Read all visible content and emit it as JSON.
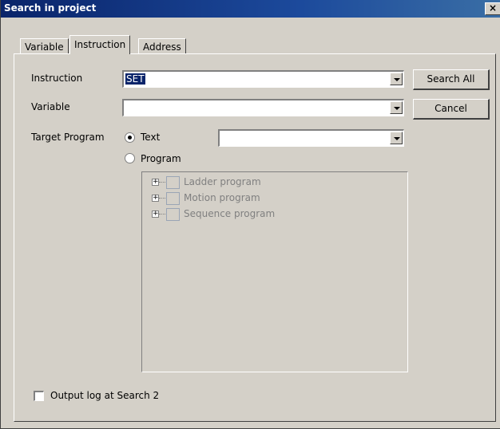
{
  "window": {
    "title": "Search in project",
    "close_glyph": "×"
  },
  "tabs": [
    {
      "label": "Variable",
      "active": false
    },
    {
      "label": "Instruction",
      "active": true
    },
    {
      "label": "Address",
      "active": false
    }
  ],
  "form": {
    "instruction_label": "Instruction",
    "instruction_value": "SET",
    "variable_label": "Variable",
    "variable_value": "",
    "target_label": "Target Program",
    "text_radio_label": "Text",
    "text_radio_selected": true,
    "text_combo_value": "",
    "program_radio_label": "Program",
    "program_radio_selected": false
  },
  "buttons": {
    "search_all": "Search All",
    "cancel": "Cancel"
  },
  "tree": {
    "items": [
      {
        "label": "Ladder program",
        "expander": "+"
      },
      {
        "label": "Motion program",
        "expander": "+"
      },
      {
        "label": "Sequence program",
        "expander": "+"
      }
    ],
    "disabled": true
  },
  "footer": {
    "output_log_label": "Output log at Search 2",
    "output_log_checked": false
  },
  "colors": {
    "titlebar": "#0a246a",
    "face": "#d4d0c8",
    "selection": "#0a246a",
    "disabled_text": "#808080"
  }
}
